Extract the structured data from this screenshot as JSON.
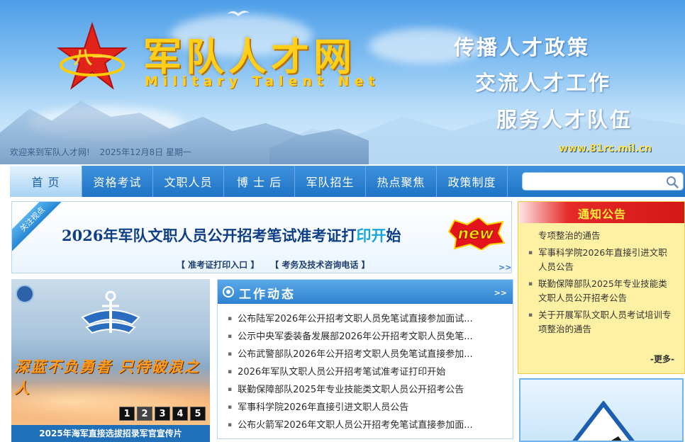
{
  "header": {
    "title": "军队人才网",
    "subtitle": "Military Talent Net",
    "slogans": [
      "传播人才政策",
      "交流人才工作",
      "服务人才队伍"
    ],
    "welcome": "欢迎来到军队人才网!",
    "date": "2025年12月8日 星期一",
    "url": "www.81rc.mil.cn"
  },
  "nav": {
    "items": [
      "首 页",
      "资格考试",
      "文职人员",
      "博 士 后",
      "军队招生",
      "热点聚焦",
      "政策制度"
    ],
    "active_index": 0,
    "search_placeholder": ""
  },
  "headline": {
    "ribbon": "关注视点",
    "title_main": "2026年军队文职人员公开招考笔试准考证打",
    "title_accent": "印开",
    "title_end": "始",
    "badge": "new",
    "links": [
      "【 准考证打印入口 】",
      "【 考务及技术咨询电话 】"
    ],
    "more": ">>"
  },
  "slider": {
    "slogan": "深蓝不负勇者 只待破浪之人",
    "pages": [
      "1",
      "2",
      "3",
      "4",
      "5"
    ],
    "active_page": 1,
    "caption": "2025年海军直接选拔招录军官宣传片"
  },
  "news": {
    "title": "工作动态",
    "more": ">>",
    "items": [
      "公布陆军2026年公开招考文职人员免笔试直接参加面试...",
      "公示中央军委装备发展部2026年公开招考文职人员免笔...",
      "公布武警部队2026年公开招考文职人员免笔试直接参加...",
      "2026年军队文职人员公开招考笔试准考证打印开始",
      "联勤保障部队2025年专业技能类文职人员公开招考公告",
      "军事科学院2026年直接引进文职人员公告",
      "公布火箭军2026年文职人员公开招考免笔试直接参加面..."
    ]
  },
  "notice": {
    "title": "通知公告",
    "items": [
      "专项整治的通告",
      "军事科学院2026年直接引进文职人员公告",
      "联勤保障部队2025年专业技能类文职人员公开招考公告",
      "关于开展军队文职人员考试培训专项整治的通告"
    ],
    "more": "-更多-"
  },
  "colors": {
    "nav_blue": "#1f73c6",
    "title_yellow": "#ffcf1a",
    "notice_red": "#d31717",
    "notice_bg": "#fff1a3"
  }
}
